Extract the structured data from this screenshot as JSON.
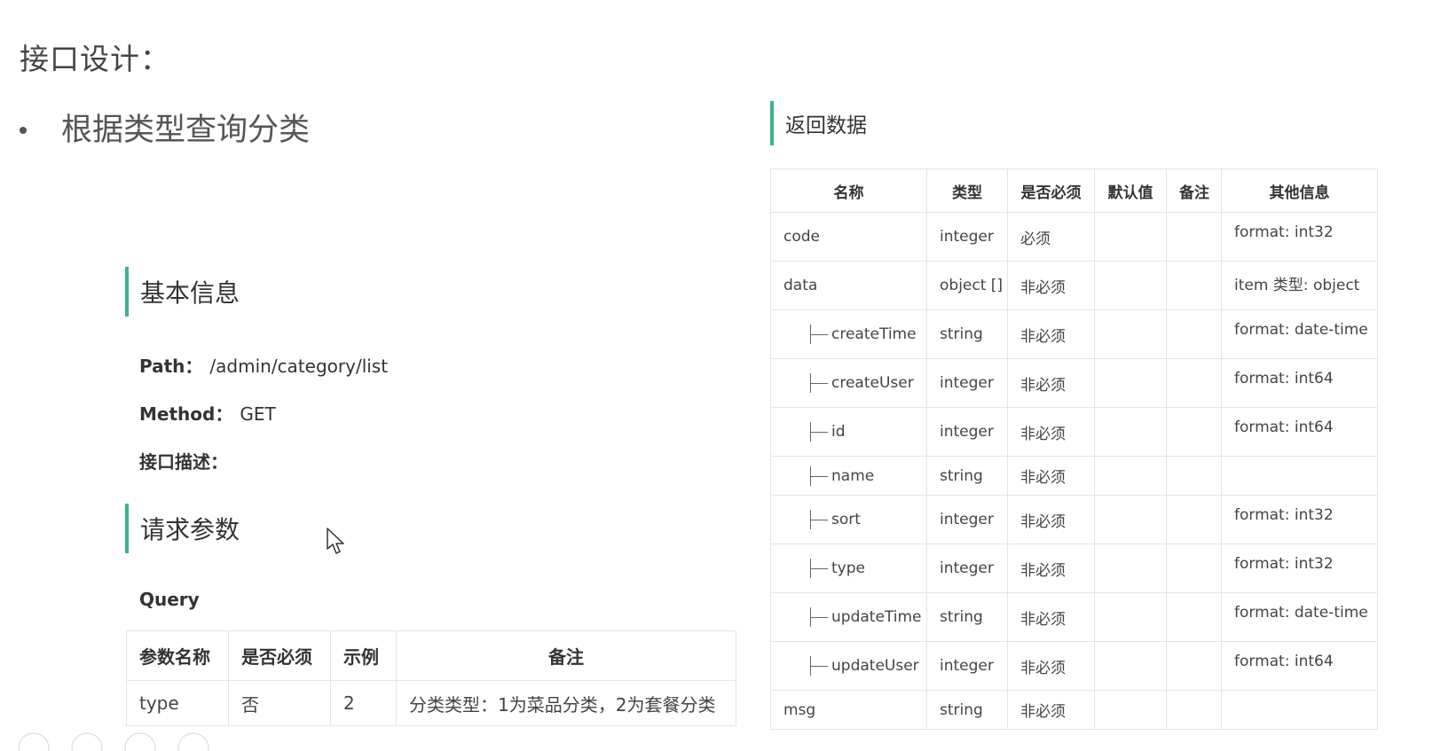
{
  "page": {
    "title": "接口设计：",
    "bullet": "根据类型查询分类"
  },
  "basic_info": {
    "heading": "基本信息",
    "path_label": "Path：",
    "path_value": "/admin/category/list",
    "method_label": "Method：",
    "method_value": "GET",
    "desc_label": "接口描述："
  },
  "request": {
    "heading": "请求参数",
    "query_label": "Query",
    "headers": [
      "参数名称",
      "是否必须",
      "示例",
      "备注"
    ],
    "rows": [
      [
        "type",
        "否",
        "2",
        "分类类型：1为菜品分类，2为套餐分类"
      ]
    ]
  },
  "response": {
    "heading": "返回数据",
    "headers": [
      "名称",
      "类型",
      "是否必须",
      "默认值",
      "备注",
      "其他信息"
    ],
    "rows": [
      {
        "name": "code",
        "child": false,
        "type": "integer",
        "required": "必须",
        "default": "",
        "remark": "",
        "info": "format: int32"
      },
      {
        "name": "data",
        "child": false,
        "type": "object []",
        "required": "非必须",
        "default": "",
        "remark": "",
        "info": "item 类型: object"
      },
      {
        "name": "createTime",
        "child": true,
        "type": "string",
        "required": "非必须",
        "default": "",
        "remark": "",
        "info": "format: date-time"
      },
      {
        "name": "createUser",
        "child": true,
        "type": "integer",
        "required": "非必须",
        "default": "",
        "remark": "",
        "info": "format: int64"
      },
      {
        "name": "id",
        "child": true,
        "type": "integer",
        "required": "非必须",
        "default": "",
        "remark": "",
        "info": "format: int64"
      },
      {
        "name": "name",
        "child": true,
        "type": "string",
        "required": "非必须",
        "default": "",
        "remark": "",
        "info": ""
      },
      {
        "name": "sort",
        "child": true,
        "type": "integer",
        "required": "非必须",
        "default": "",
        "remark": "",
        "info": "format: int32"
      },
      {
        "name": "type",
        "child": true,
        "type": "integer",
        "required": "非必须",
        "default": "",
        "remark": "",
        "info": "format: int32"
      },
      {
        "name": "updateTime",
        "child": true,
        "type": "string",
        "required": "非必须",
        "default": "",
        "remark": "",
        "info": "format: date-time"
      },
      {
        "name": "updateUser",
        "child": true,
        "type": "integer",
        "required": "非必须",
        "default": "",
        "remark": "",
        "info": "format: int64"
      },
      {
        "name": "msg",
        "child": false,
        "type": "string",
        "required": "非必须",
        "default": "",
        "remark": "",
        "info": ""
      }
    ]
  },
  "icons": {
    "cursor": "mouse-pointer-icon",
    "bullet": "bullet-dot-icon",
    "tree": "tree-branch-icon"
  },
  "colors": {
    "accent": "#3bb588",
    "border": "#e4e4e4",
    "text": "#333333"
  }
}
